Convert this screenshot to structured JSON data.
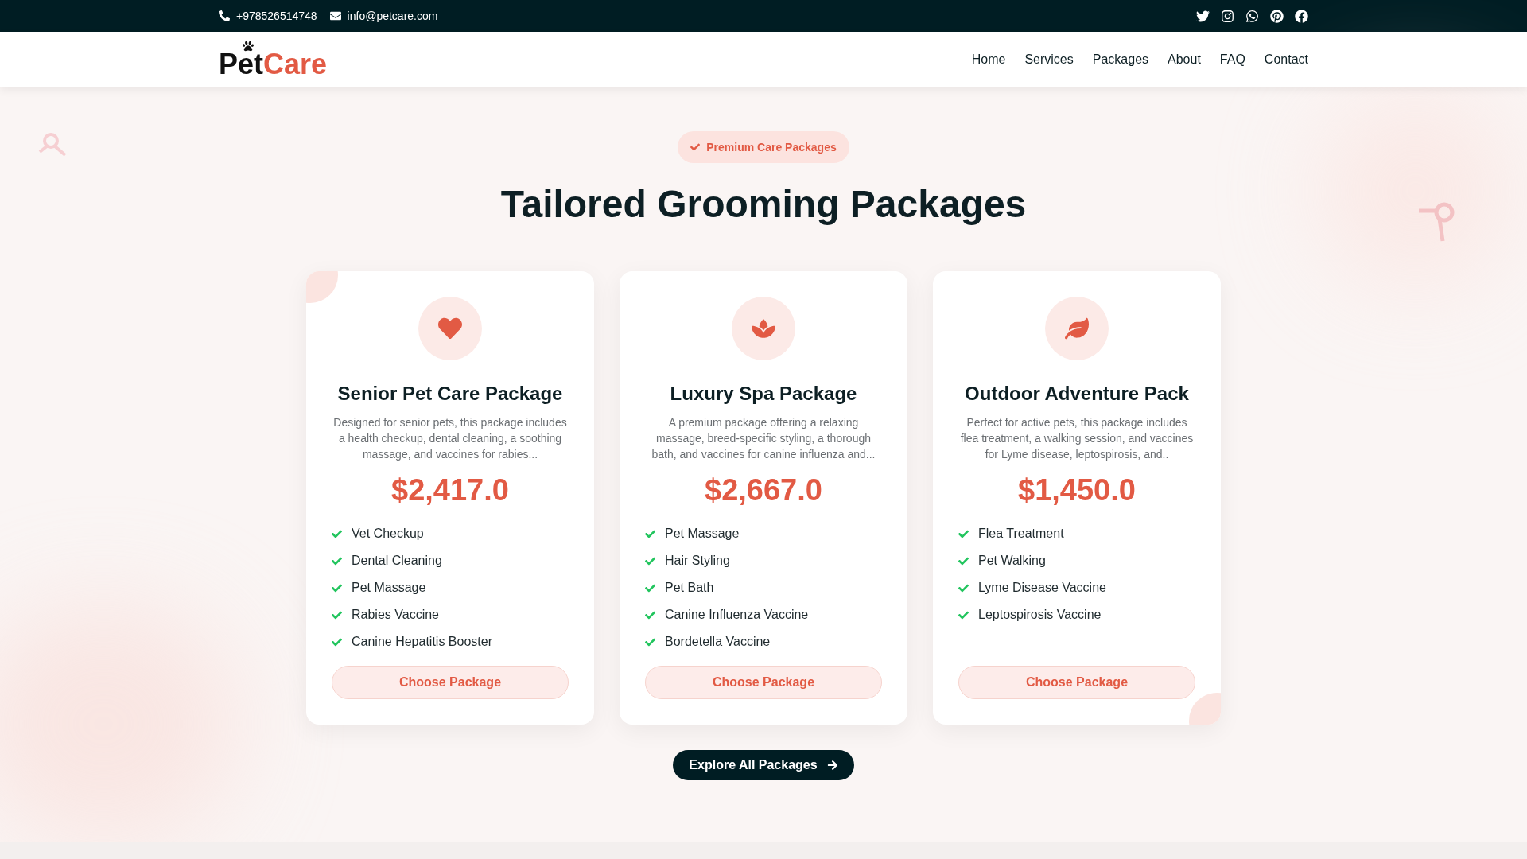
{
  "topbar": {
    "phone": "+978526514748",
    "email": "info@petcare.com"
  },
  "logo": {
    "first": "Pet",
    "second": "Care"
  },
  "nav": [
    "Home",
    "Services",
    "Packages",
    "About",
    "FAQ",
    "Contact"
  ],
  "section": {
    "badge": "Premium Care Packages",
    "title": "Tailored Grooming Packages"
  },
  "packages": [
    {
      "kind": "heart",
      "title": "Senior Pet Care Package",
      "description": "Designed for senior pets, this package includes a health checkup, dental cleaning, a soothing massage, and vaccines for rabies...",
      "price": "$2,417.0",
      "features": [
        "Vet Checkup",
        "Dental Cleaning",
        "Pet Massage",
        "Rabies Vaccine",
        "Canine Hepatitis Booster"
      ],
      "button": "Choose Package"
    },
    {
      "kind": "lotus",
      "title": "Luxury Spa Package",
      "description": "A premium package offering a relaxing massage, breed-specific styling, a thorough bath, and vaccines for canine influenza and...",
      "price": "$2,667.0",
      "features": [
        "Pet Massage",
        "Hair Styling",
        "Pet Bath",
        "Canine Influenza Vaccine",
        "Bordetella Vaccine"
      ],
      "button": "Choose Package"
    },
    {
      "kind": "leaf",
      "title": "Outdoor Adventure Pack",
      "description": "Perfect for active pets, this package includes flea treatment, a walking session, and vaccines for Lyme disease, leptospirosis, and..",
      "price": "$1,450.0",
      "features": [
        "Flea Treatment",
        "Pet Walking",
        "Lyme Disease Vaccine",
        "Leptospirosis Vaccine"
      ],
      "button": "Choose Package"
    }
  ],
  "explore": "Explore All Packages"
}
